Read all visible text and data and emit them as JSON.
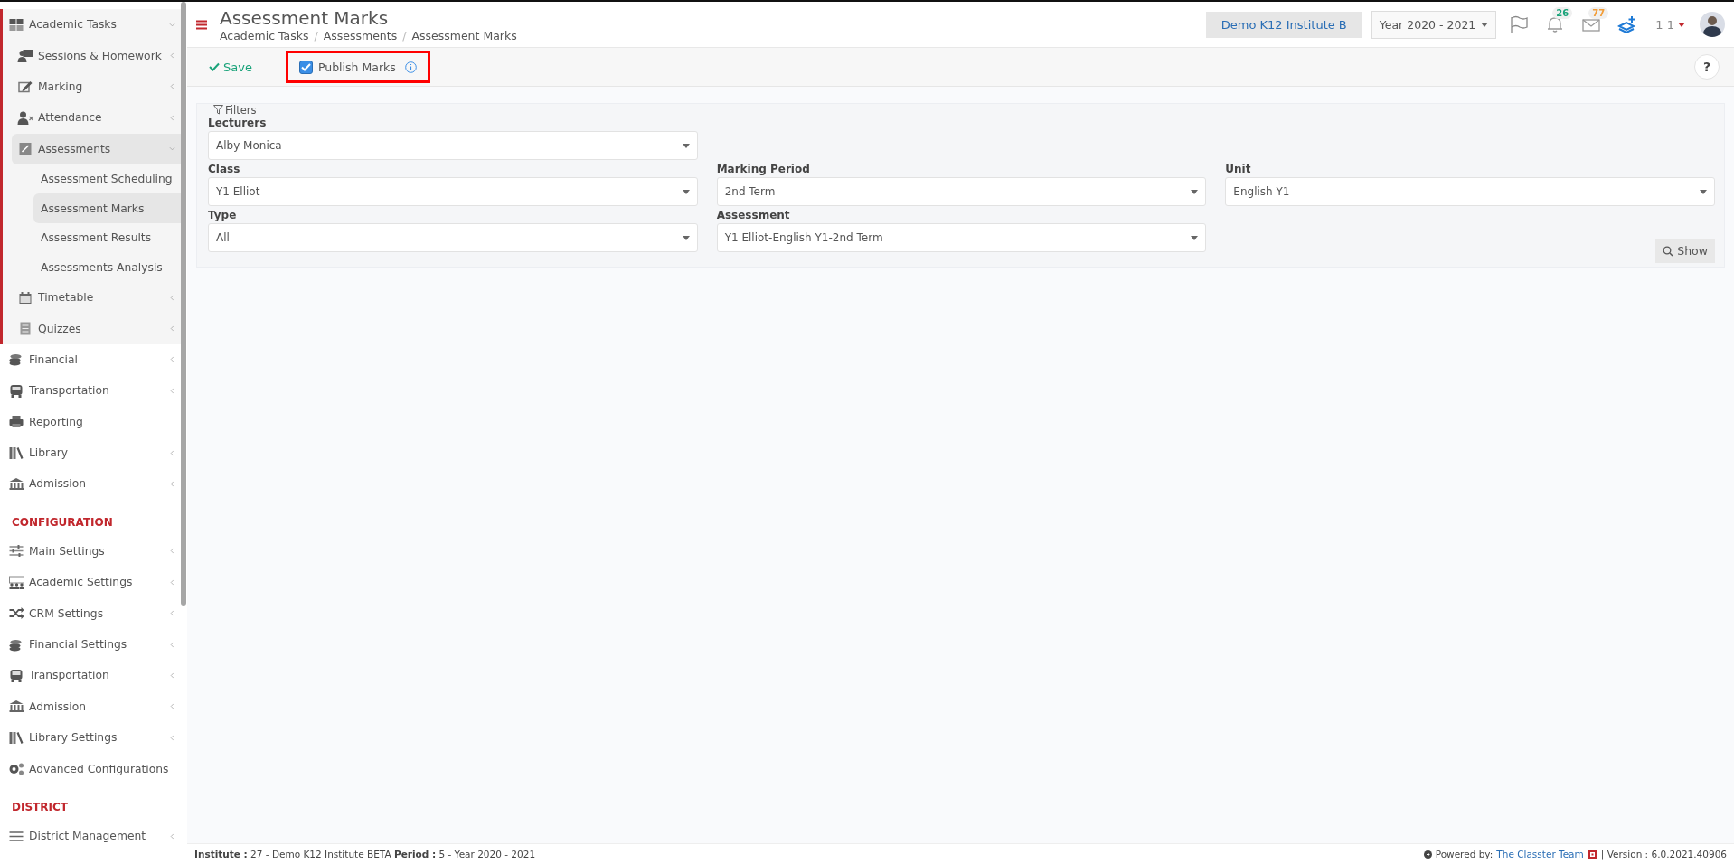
{
  "sidebar": {
    "sections": [
      {
        "items": [
          {
            "label": "Academic Tasks",
            "kind": "group",
            "expanded": true,
            "selected": false,
            "children": [
              {
                "label": "Sessions & Homework",
                "kind": "group",
                "expanded": false,
                "selected": false
              },
              {
                "label": "Marking",
                "kind": "group",
                "expanded": false,
                "selected": false
              },
              {
                "label": "Attendance",
                "kind": "group",
                "expanded": false,
                "selected": false
              },
              {
                "label": "Assessments",
                "kind": "group",
                "expanded": true,
                "selected": true,
                "children": [
                  {
                    "label": "Assessment Scheduling",
                    "kind": "link",
                    "selected": false
                  },
                  {
                    "label": "Assessment Marks",
                    "kind": "link",
                    "selected": true
                  },
                  {
                    "label": "Assessment Results",
                    "kind": "link",
                    "selected": false
                  },
                  {
                    "label": "Assessments Analysis",
                    "kind": "link",
                    "selected": false
                  }
                ]
              },
              {
                "label": "Timetable",
                "kind": "group",
                "expanded": false,
                "selected": false
              },
              {
                "label": "Quizzes",
                "kind": "group",
                "expanded": false,
                "selected": false
              }
            ]
          },
          {
            "label": "Financial",
            "kind": "group",
            "expanded": false,
            "selected": false
          },
          {
            "label": "Transportation",
            "kind": "group",
            "expanded": false,
            "selected": false
          },
          {
            "label": "Reporting",
            "kind": "link",
            "selected": false
          },
          {
            "label": "Library",
            "kind": "group",
            "expanded": false,
            "selected": false
          },
          {
            "label": "Admission",
            "kind": "group",
            "expanded": false,
            "selected": false
          }
        ]
      },
      {
        "heading": "CONFIGURATION",
        "items": [
          {
            "label": "Main Settings",
            "kind": "group",
            "expanded": false,
            "selected": false
          },
          {
            "label": "Academic Settings",
            "kind": "group",
            "expanded": false,
            "selected": false
          },
          {
            "label": "CRM Settings",
            "kind": "group",
            "expanded": false,
            "selected": false
          },
          {
            "label": "Financial Settings",
            "kind": "group",
            "expanded": false,
            "selected": false
          },
          {
            "label": "Transportation",
            "kind": "group",
            "expanded": false,
            "selected": false
          },
          {
            "label": "Admission",
            "kind": "group",
            "expanded": false,
            "selected": false
          },
          {
            "label": "Library Settings",
            "kind": "group",
            "expanded": false,
            "selected": false
          },
          {
            "label": "Advanced Configurations",
            "kind": "link",
            "selected": false
          }
        ]
      },
      {
        "heading": "DISTRICT",
        "items": [
          {
            "label": "District Management",
            "kind": "group",
            "expanded": false,
            "selected": false
          }
        ]
      }
    ]
  },
  "header": {
    "title": "Assessment Marks",
    "breadcrumbs": [
      {
        "kind": "crumb",
        "text": "Academic Tasks"
      },
      {
        "kind": "separator",
        "text": "/"
      },
      {
        "kind": "crumb",
        "text": "Assessments"
      },
      {
        "kind": "separator",
        "text": "/"
      },
      {
        "kind": "crumb",
        "text": "Assessment Marks"
      }
    ],
    "institute": "Demo K12 Institute B",
    "year": "Year 2020 - 2021",
    "notifications": "26",
    "messages": "77",
    "user": "1 1"
  },
  "toolbar": {
    "save": "Save",
    "publish": {
      "label": "Publish Marks",
      "checked": true
    },
    "help": "?"
  },
  "filters": {
    "legend": "Filters",
    "rows": [
      [
        {
          "label": "Lecturers",
          "value": "Alby Monica"
        }
      ],
      [
        {
          "label": "Class",
          "value": "Y1 Elliot"
        },
        {
          "label": "Marking Period",
          "value": "2nd Term"
        },
        {
          "label": "Unit",
          "value": "English Y1"
        }
      ],
      [
        {
          "label": "Type",
          "value": "All"
        },
        {
          "label": "Assessment",
          "value": "Y1 Elliot-English Y1-2nd Term"
        }
      ]
    ],
    "show": "Show"
  },
  "footer": {
    "info": "**Institute :** 27 - Demo K12 Institute BETA **Period :** 5 - Year 2020 - 2021",
    "powered": "Powered by:",
    "team": "The Classter Team",
    "version": "| Version : 6.0.2021.40906"
  }
}
